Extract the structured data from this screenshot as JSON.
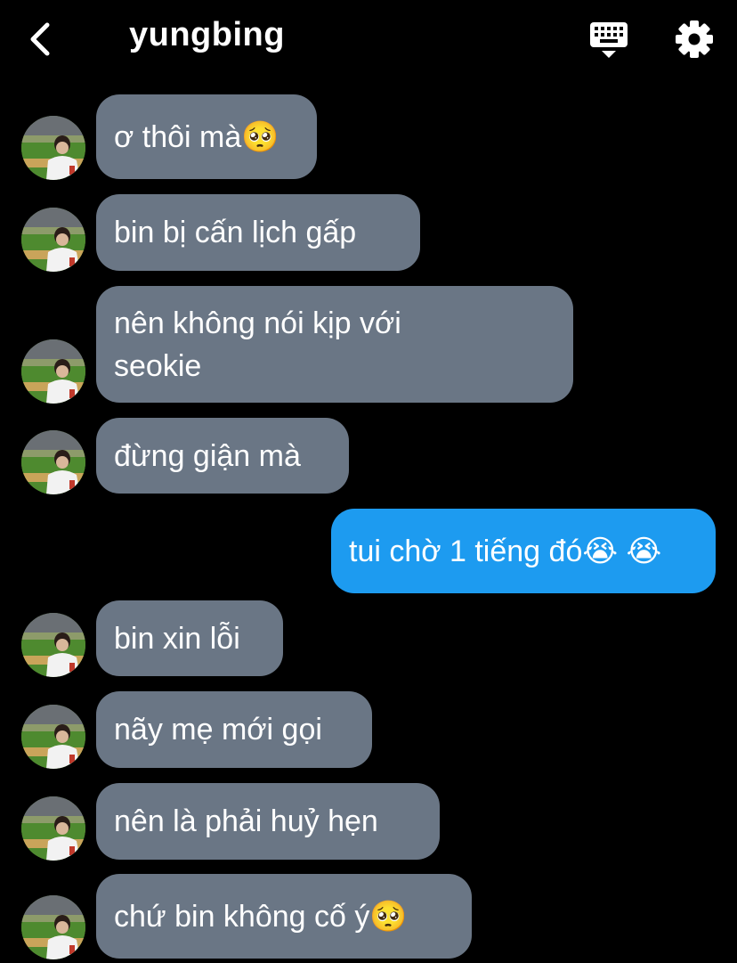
{
  "header": {
    "back_icon": "chevron-left-icon",
    "title": "yungbing",
    "keyboard_icon": "keyboard-icon",
    "settings_icon": "gear-icon"
  },
  "messages": [
    {
      "direction": "in",
      "text": "ơ thôi mà🥺"
    },
    {
      "direction": "in",
      "text": "bin bị cấn lịch gấp"
    },
    {
      "direction": "in",
      "text": "nên không nói kịp với\nseokie"
    },
    {
      "direction": "in",
      "text": "đừng giận mà"
    },
    {
      "direction": "out",
      "text": "tui chờ 1 tiếng đó😭 😭"
    },
    {
      "direction": "in",
      "text": "bin xin lỗi"
    },
    {
      "direction": "in",
      "text": "nãy mẹ mới gọi"
    },
    {
      "direction": "in",
      "text": "nên là phải huỷ hẹn"
    },
    {
      "direction": "in",
      "text": "chứ bin không cố ý🥺"
    }
  ],
  "colors": {
    "background": "#000000",
    "incoming_bubble": "#6a7685",
    "outgoing_bubble": "#1d9bf0"
  }
}
